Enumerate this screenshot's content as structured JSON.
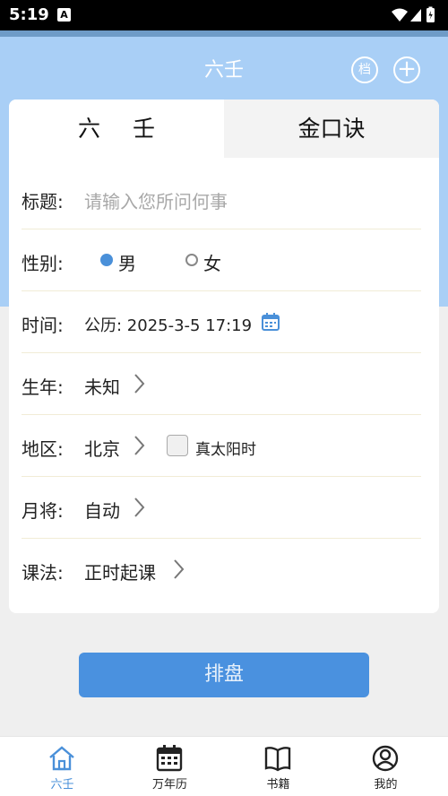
{
  "status": {
    "time": "5:19",
    "badge": "A"
  },
  "header": {
    "title": "六壬",
    "archive_label": "档",
    "add_label": "+"
  },
  "tabs": [
    {
      "label": "六 壬",
      "active": true
    },
    {
      "label": "金口诀",
      "active": false
    }
  ],
  "form": {
    "title": {
      "label": "标题:",
      "placeholder": "请输入您所问何事"
    },
    "gender": {
      "label": "性别:",
      "options": [
        "男",
        "女"
      ],
      "selected": "男"
    },
    "time": {
      "label": "时间:",
      "value": "公历: 2025-3-5 17:19"
    },
    "birth_year": {
      "label": "生年:",
      "value": "未知"
    },
    "region": {
      "label": "地区:",
      "value": "北京",
      "checkbox_label": "真太阳时",
      "checked": false
    },
    "month_general": {
      "label": "月将:",
      "value": "自动"
    },
    "method": {
      "label": "课法:",
      "value": "正时起课"
    }
  },
  "submit": {
    "label": "排盘"
  },
  "nav": [
    {
      "label": "六壬",
      "icon": "home-icon",
      "active": true
    },
    {
      "label": "万年历",
      "icon": "calendar-icon",
      "active": false
    },
    {
      "label": "书籍",
      "icon": "book-icon",
      "active": false
    },
    {
      "label": "我的",
      "icon": "profile-icon",
      "active": false
    }
  ],
  "colors": {
    "accent": "#4a90d9",
    "header_bg": "#a9cff6",
    "button": "#4a91df"
  }
}
